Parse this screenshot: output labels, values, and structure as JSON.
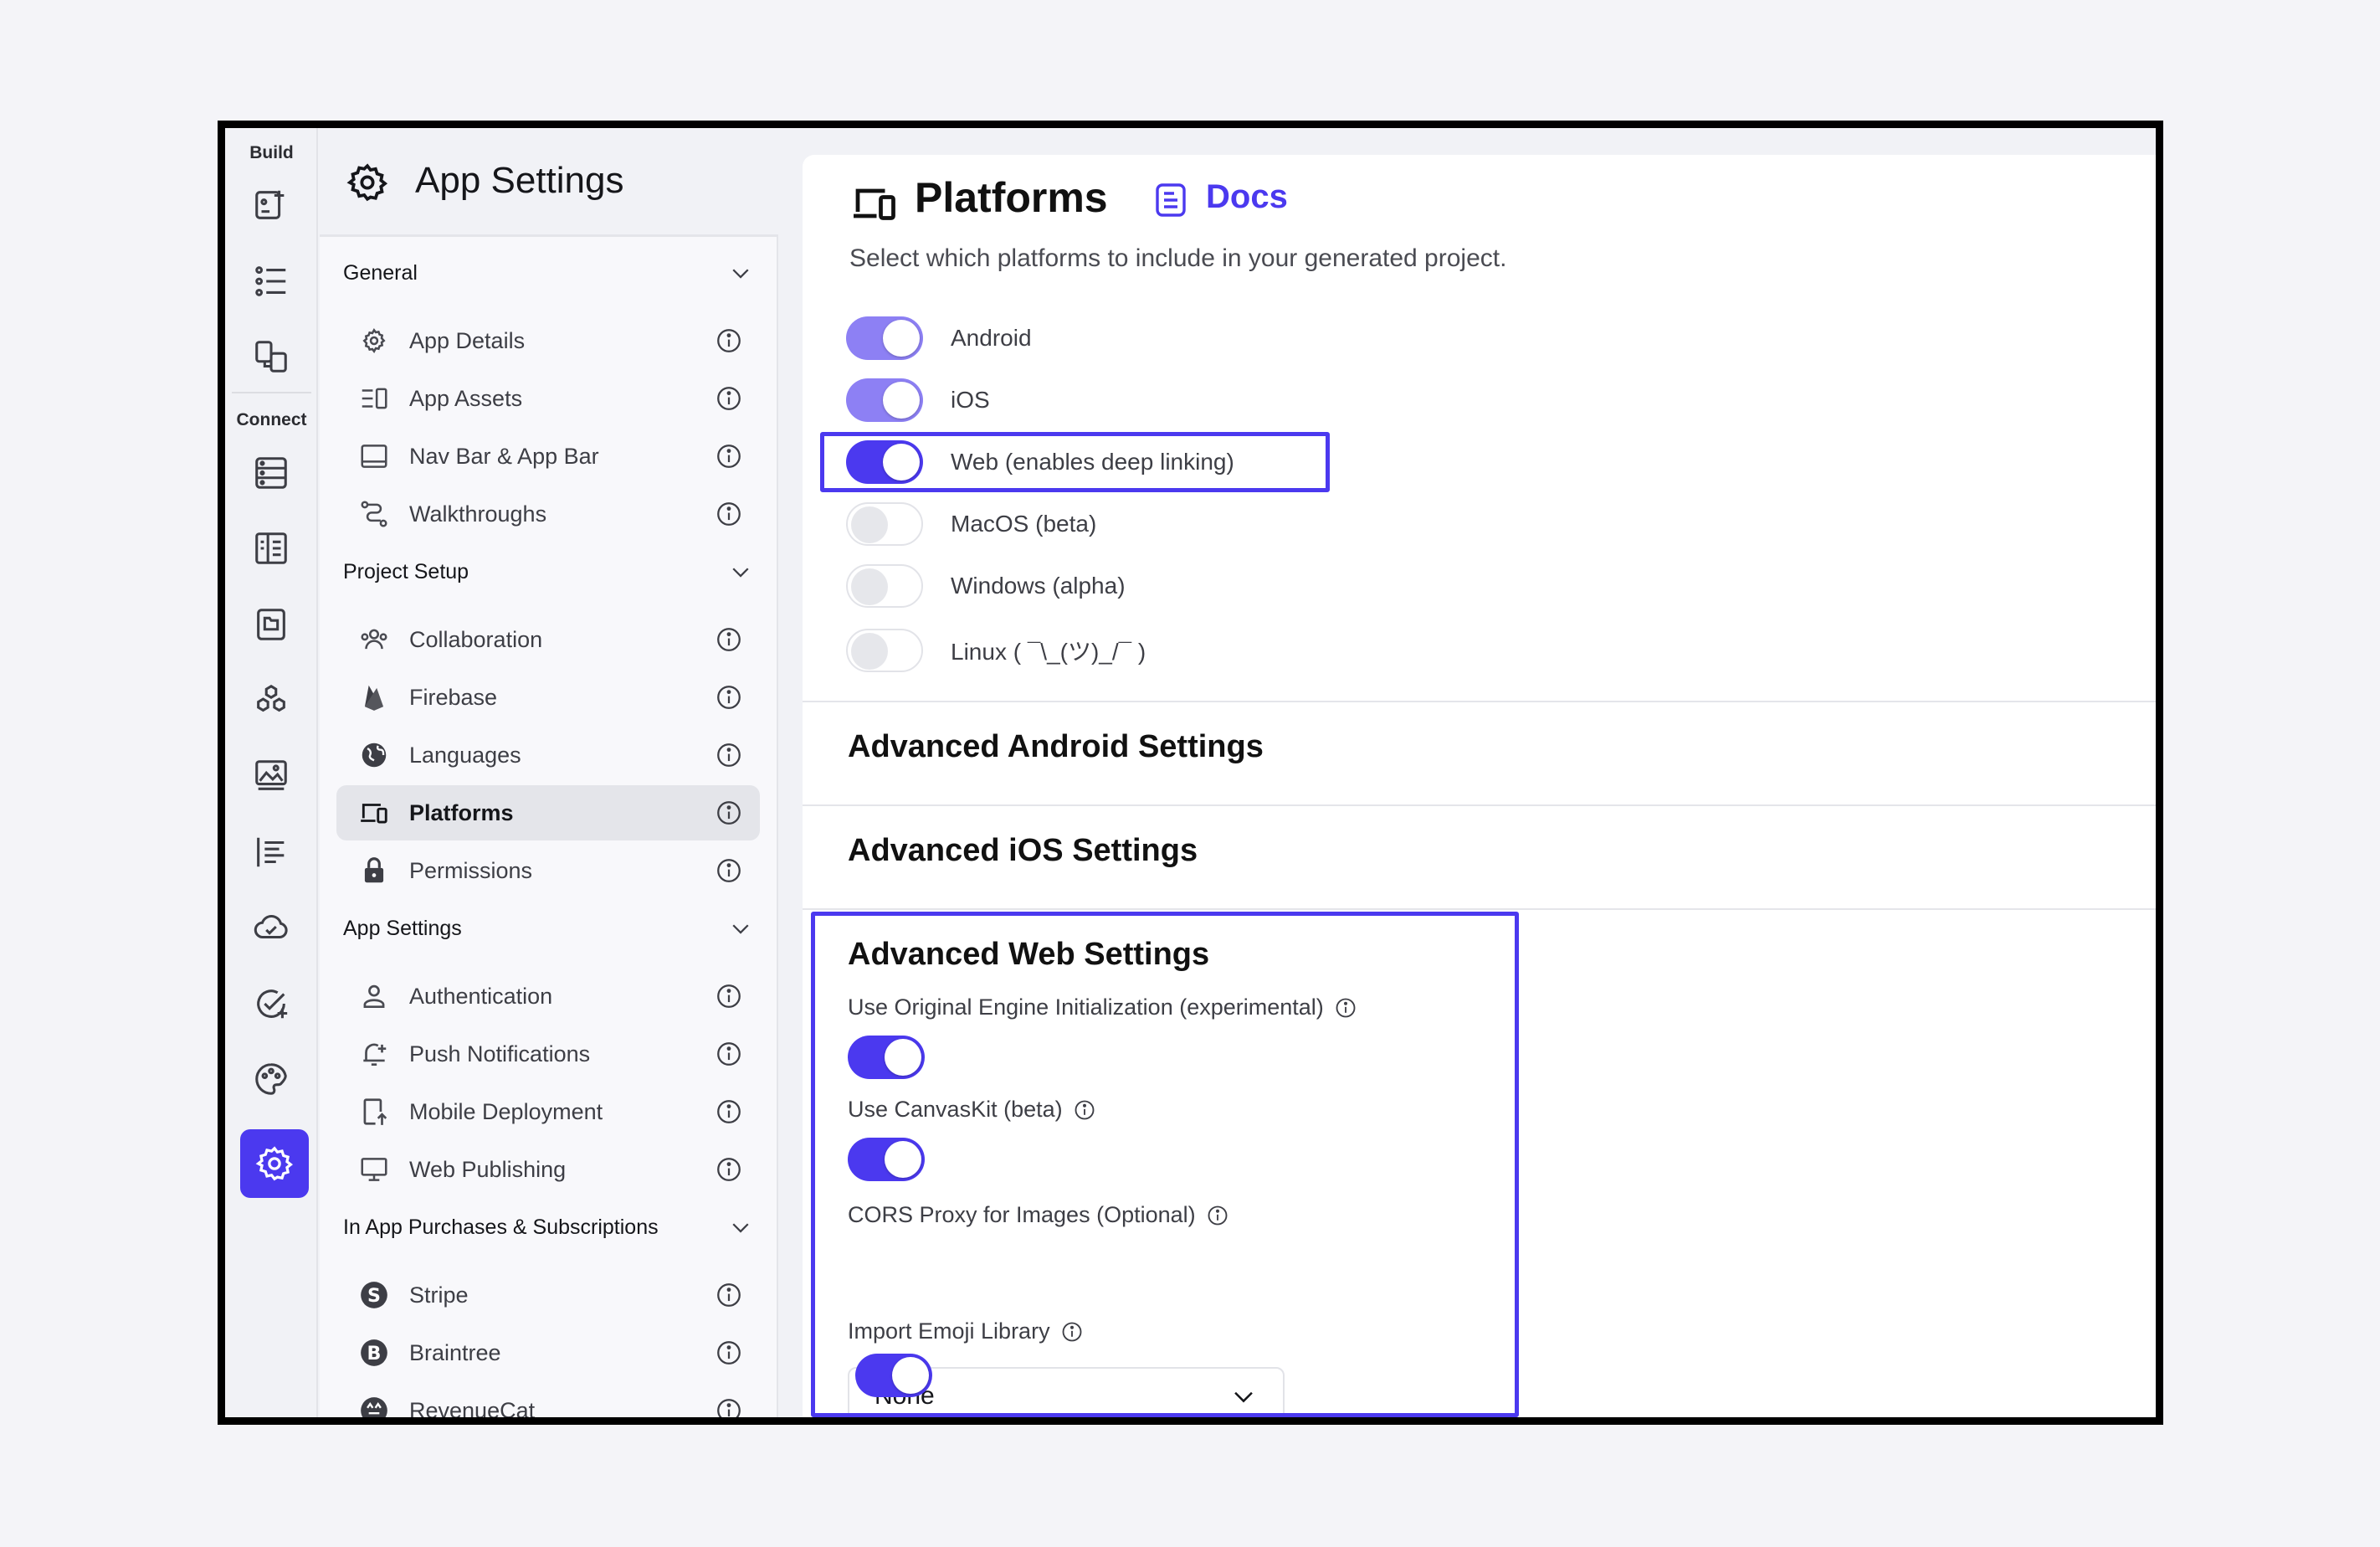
{
  "rail": {
    "build_label": "Build",
    "connect_label": "Connect"
  },
  "nav": {
    "title": "App Settings",
    "groups": [
      {
        "label": "General",
        "items": [
          {
            "label": "App Details",
            "icon": "gear-badge-icon"
          },
          {
            "label": "App Assets",
            "icon": "assets-icon"
          },
          {
            "label": "Nav Bar & App Bar",
            "icon": "navbar-icon"
          },
          {
            "label": "Walkthroughs",
            "icon": "route-icon"
          }
        ]
      },
      {
        "label": "Project Setup",
        "items": [
          {
            "label": "Collaboration",
            "icon": "people-icon"
          },
          {
            "label": "Firebase",
            "icon": "firebase-icon"
          },
          {
            "label": "Languages",
            "icon": "globe-icon"
          },
          {
            "label": "Platforms",
            "icon": "devices-icon",
            "active": true
          },
          {
            "label": "Permissions",
            "icon": "lock-icon"
          }
        ]
      },
      {
        "label": "App Settings",
        "items": [
          {
            "label": "Authentication",
            "icon": "person-icon"
          },
          {
            "label": "Push Notifications",
            "icon": "bell-icon"
          },
          {
            "label": "Mobile Deployment",
            "icon": "mobile-upload-icon"
          },
          {
            "label": "Web Publishing",
            "icon": "monitor-icon"
          }
        ]
      },
      {
        "label": "In App Purchases & Subscriptions",
        "items": [
          {
            "label": "Stripe",
            "icon": "stripe-icon"
          },
          {
            "label": "Braintree",
            "icon": "braintree-icon"
          },
          {
            "label": "RevenueCat",
            "icon": "revenuecat-icon"
          }
        ]
      }
    ]
  },
  "main": {
    "title": "Platforms",
    "docs_label": "Docs",
    "subtitle": "Select which platforms to include in your generated project.",
    "platforms": [
      {
        "label": "Android",
        "on": true
      },
      {
        "label": "iOS",
        "on": true
      },
      {
        "label": "Web (enables deep linking)",
        "on": true
      },
      {
        "label": "MacOS (beta)",
        "on": false
      },
      {
        "label": "Windows (alpha)",
        "on": false
      },
      {
        "label": "Linux ( ¯\\_(ツ)_/¯ )",
        "on": false
      }
    ],
    "sections": {
      "android": "Advanced Android Settings",
      "ios": "Advanced iOS Settings",
      "web": "Advanced Web Settings"
    },
    "web_settings": {
      "engine_label": "Use Original Engine Initialization (experimental)",
      "engine_on": true,
      "canvaskit_label": "Use CanvasKit (beta)",
      "canvaskit_on": true,
      "cors_label": "CORS Proxy for Images (Optional)",
      "cors_value": "None",
      "emoji_label": "Import Emoji Library",
      "emoji_on": true
    }
  },
  "colors": {
    "accent": "#4b39ef",
    "accent_light": "#8d80f4"
  }
}
